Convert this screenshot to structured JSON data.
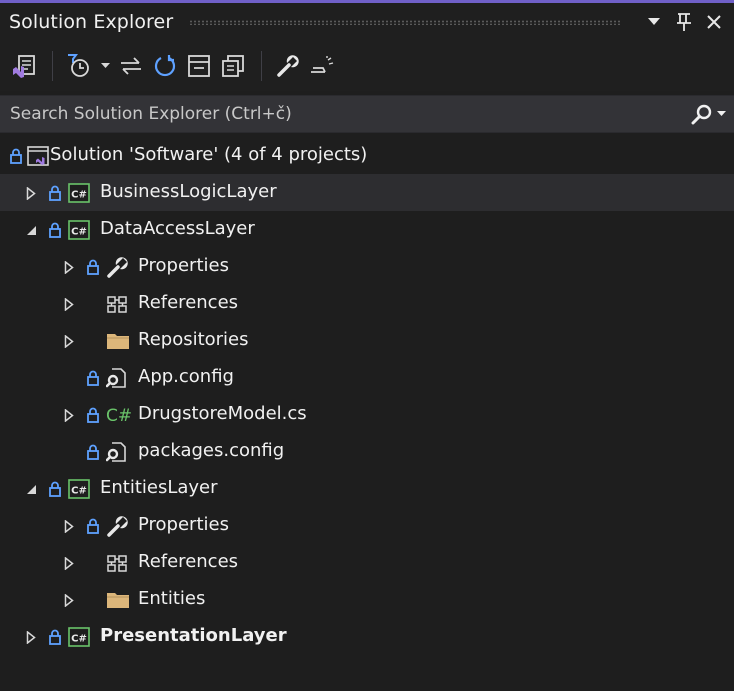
{
  "panel": {
    "title": "Solution Explorer"
  },
  "search": {
    "placeholder": "Search Solution Explorer (Ctrl+č)"
  },
  "colors": {
    "accent": "#7060c8",
    "background": "#1e1e1e",
    "search_background": "#333337",
    "hover_row": "#2d2d30",
    "lock_blue": "#5ea1ff",
    "csharp_green": "#6ac36a",
    "folder_yellow": "#dcb67a",
    "vs_purple": "#a07be0"
  },
  "toolbar": {
    "buttons": [
      {
        "name": "switch-views-button",
        "icon": "vs-solution-icon"
      },
      {
        "name": "pending-changes-filter-button",
        "icon": "clock-filter-icon"
      },
      {
        "name": "sync-with-active-document-button",
        "icon": "sync-arrows-icon"
      },
      {
        "name": "refresh-button",
        "icon": "refresh-icon"
      },
      {
        "name": "collapse-all-button",
        "icon": "collapse-all-icon"
      },
      {
        "name": "show-all-files-button",
        "icon": "show-all-files-icon"
      },
      {
        "name": "properties-button",
        "icon": "wrench-icon"
      },
      {
        "name": "preview-selected-items-button",
        "icon": "preview-icon"
      }
    ]
  },
  "tree": {
    "solution": {
      "label": "Solution 'Software' (4 of 4 projects)",
      "icon": "solution-icon",
      "locked": true
    },
    "items": [
      {
        "label": "BusinessLogicLayer",
        "icon": "csharp-project-icon",
        "level": 1,
        "expander": "collapsed",
        "locked": true,
        "bold": false
      },
      {
        "label": "DataAccessLayer",
        "icon": "csharp-project-icon",
        "level": 1,
        "expander": "expanded",
        "locked": true,
        "bold": false
      },
      {
        "label": "Properties",
        "icon": "wrench-icon",
        "level": 2,
        "expander": "collapsed",
        "locked": true,
        "bold": false
      },
      {
        "label": "References",
        "icon": "references-icon",
        "level": 2,
        "expander": "collapsed",
        "locked": false,
        "bold": false
      },
      {
        "label": "Repositories",
        "icon": "folder-icon",
        "level": 2,
        "expander": "collapsed",
        "locked": false,
        "bold": false
      },
      {
        "label": "App.config",
        "icon": "config-file-icon",
        "level": 2,
        "expander": "none",
        "locked": true,
        "bold": false
      },
      {
        "label": "DrugstoreModel.cs",
        "icon": "csharp-file-icon",
        "level": 2,
        "expander": "collapsed",
        "locked": true,
        "bold": false
      },
      {
        "label": "packages.config",
        "icon": "config-file-icon",
        "level": 2,
        "expander": "none",
        "locked": true,
        "bold": false
      },
      {
        "label": "EntitiesLayer",
        "icon": "csharp-project-icon",
        "level": 1,
        "expander": "expanded",
        "locked": true,
        "bold": false
      },
      {
        "label": "Properties",
        "icon": "wrench-icon",
        "level": 2,
        "expander": "collapsed",
        "locked": true,
        "bold": false
      },
      {
        "label": "References",
        "icon": "references-icon",
        "level": 2,
        "expander": "collapsed",
        "locked": false,
        "bold": false
      },
      {
        "label": "Entities",
        "icon": "folder-icon",
        "level": 2,
        "expander": "collapsed",
        "locked": false,
        "bold": false
      },
      {
        "label": "PresentationLayer",
        "icon": "csharp-project-icon",
        "level": 1,
        "expander": "collapsed",
        "locked": true,
        "bold": true
      }
    ]
  }
}
